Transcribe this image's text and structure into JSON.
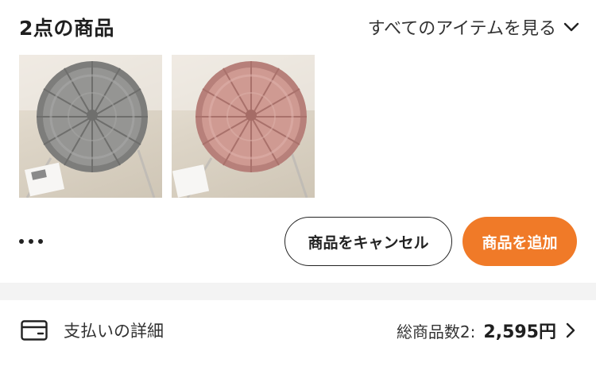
{
  "order": {
    "item_count_title": "2点の商品",
    "view_all_label": "すべてのアイテムを見る",
    "thumbnails": [
      {
        "icon": "gray-pumpkin-cushion",
        "color": "#8f8f8d"
      },
      {
        "icon": "pink-pumpkin-cushion",
        "color": "#c98f86"
      }
    ],
    "actions": {
      "cancel_label": "商品をキャンセル",
      "add_label": "商品を追加",
      "accent_color": "#f07a28"
    }
  },
  "payment": {
    "label": "支払いの詳細",
    "total_label": "総商品数2:",
    "total_price": "2,595円"
  }
}
